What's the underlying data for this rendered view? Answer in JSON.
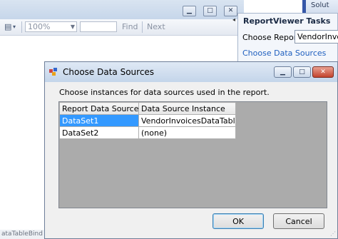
{
  "background_window": {
    "toolbar": {
      "zoom_value": "100%",
      "find_label": "Find",
      "next_label": "Next"
    },
    "status_text": "ataTableBind"
  },
  "smart_tag": {
    "header_fragment": "Solut",
    "title": "ReportViewer Tasks",
    "choose_report_label": "Choose Report",
    "choose_report_value": "VendorInvoices",
    "choose_data_sources_link": "Choose Data Sources"
  },
  "dialog": {
    "title": "Choose Data Sources",
    "prompt": "Choose instances for data sources used in the report.",
    "columns": [
      "Report Data Source",
      "Data Source Instance"
    ],
    "rows": [
      {
        "source": "DataSet1",
        "instance": "VendorInvoicesDataTableBin..."
      },
      {
        "source": "DataSet2",
        "instance": "(none)"
      }
    ],
    "ok_label": "OK",
    "cancel_label": "Cancel",
    "selection_color": "#3399ff"
  }
}
